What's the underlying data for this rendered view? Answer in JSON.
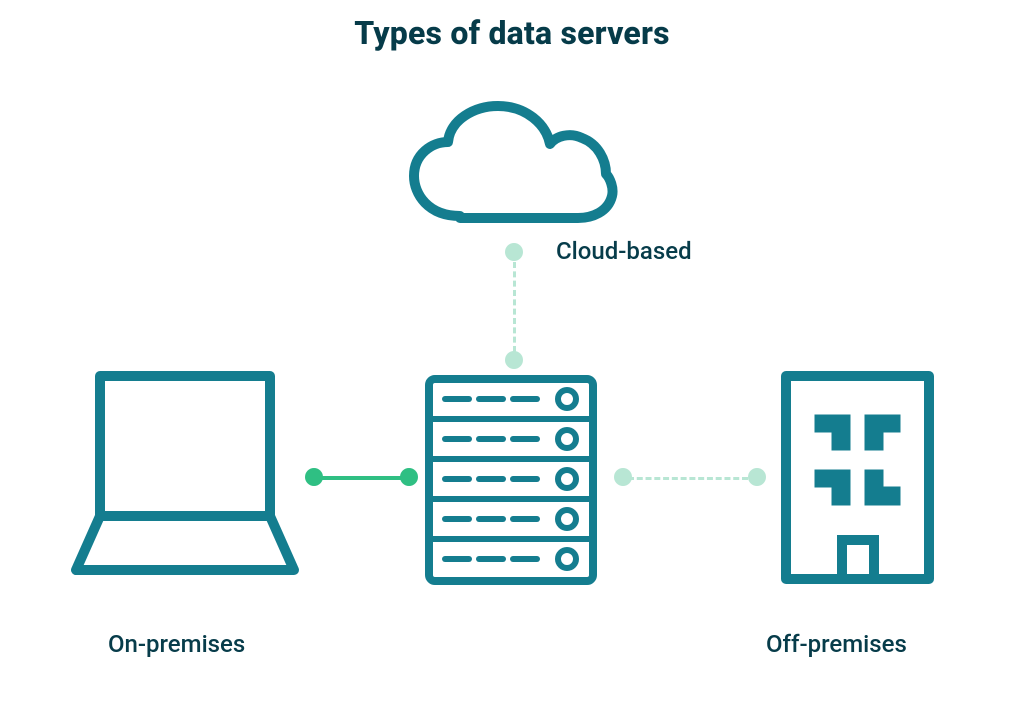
{
  "title": "Types of data servers",
  "labels": {
    "cloud": "Cloud-based",
    "on_premises": "On-premises",
    "off_premises": "Off-premises"
  },
  "icons": {
    "cloud": "cloud-icon",
    "server": "server-rack-icon",
    "laptop": "laptop-icon",
    "building": "building-icon"
  },
  "connectors": {
    "cloud_to_server": {
      "style": "dashed",
      "color_hex": "#b8e6d4"
    },
    "laptop_to_server": {
      "style": "solid",
      "color_hex": "#2fbf83"
    },
    "server_to_building": {
      "style": "dashed",
      "color_hex": "#b8e6d4"
    }
  },
  "colors": {
    "teal_stroke": "#147d8f",
    "dark_text": "#063b49",
    "mint": "#b8e6d4",
    "green": "#2fbf83"
  }
}
